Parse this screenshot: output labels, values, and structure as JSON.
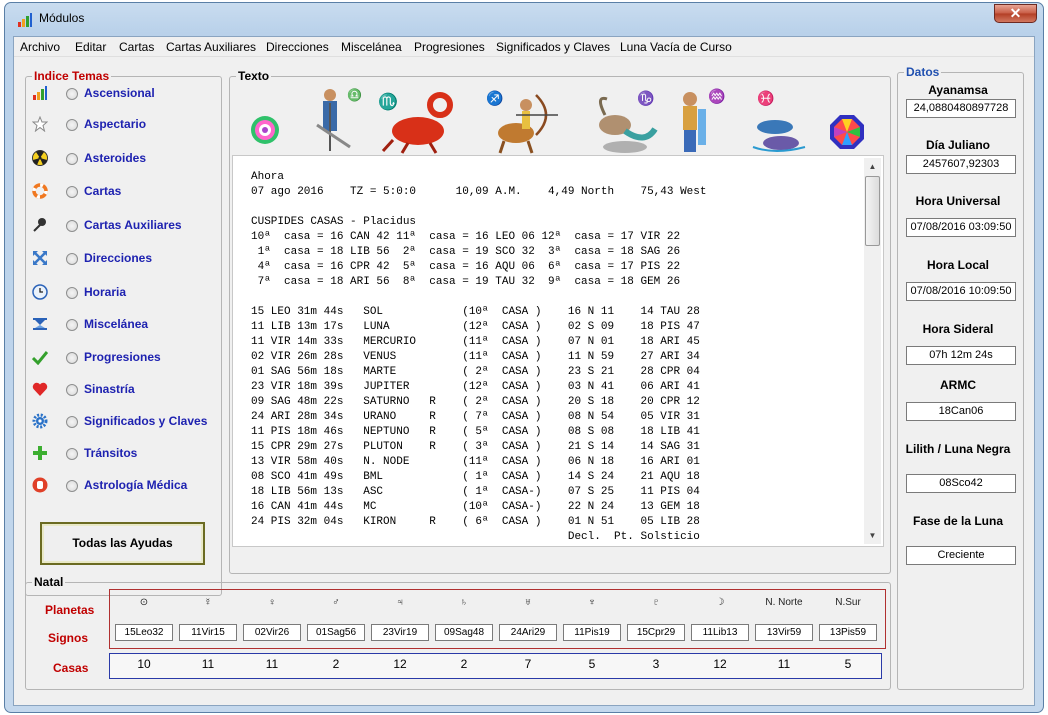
{
  "window": {
    "title": "Módulos",
    "close": "✕"
  },
  "menu": [
    "Archivo",
    "Editar",
    "Cartas",
    "Cartas Auxiliares",
    "Direcciones",
    "Miscelánea",
    "Progresiones",
    "Significados y Claves",
    "Luna Vacía de Curso"
  ],
  "indice": {
    "title": "Indice Temas",
    "items": [
      {
        "label": "Ascensional",
        "icon": "bar-chart-icon"
      },
      {
        "label": "Aspectario",
        "icon": "star-icon"
      },
      {
        "label": "Asteroides",
        "icon": "radiation-icon"
      },
      {
        "label": "Cartas",
        "icon": "lifebuoy-icon"
      },
      {
        "label": "Cartas Auxiliares",
        "icon": "pushpin-icon"
      },
      {
        "label": "Direcciones",
        "icon": "arrows-icon"
      },
      {
        "label": "Horaria",
        "icon": "clock-icon"
      },
      {
        "label": "Miscelánea",
        "icon": "hourglass-icon"
      },
      {
        "label": "Progresiones",
        "icon": "checkmark-icon"
      },
      {
        "label": "Sinastría",
        "icon": "heart-icon"
      },
      {
        "label": "Significados y Claves",
        "icon": "gear-icon"
      },
      {
        "label": "Tránsitos",
        "icon": "plus-icon"
      },
      {
        "label": "Astrología Médica",
        "icon": "hand-icon"
      }
    ],
    "button": "Todas las Ayudas"
  },
  "texto": {
    "title": "Texto",
    "content": "Ahora\n07 ago 2016    TZ = 5:0:0      10,09 A.M.    4,49 North    75,43 West\n\nCUSPIDES CASAS - Placidus\n10ª  casa = 16 CAN 42 11ª  casa = 16 LEO 06 12ª  casa = 17 VIR 22\n 1ª  casa = 18 LIB 56  2ª  casa = 19 SCO 32  3ª  casa = 18 SAG 26\n 4ª  casa = 16 CPR 42  5ª  casa = 16 AQU 06  6ª  casa = 17 PIS 22\n 7ª  casa = 18 ARI 56  8ª  casa = 19 TAU 32  9ª  casa = 18 GEM 26\n\n15 LEO 31m 44s   SOL            (10ª  CASA )    16 N 11    14 TAU 28\n11 LIB 13m 17s   LUNA           (12ª  CASA )    02 S 09    18 PIS 47\n11 VIR 14m 33s   MERCURIO       (11ª  CASA )    07 N 01    18 ARI 45\n02 VIR 26m 28s   VENUS          (11ª  CASA )    11 N 59    27 ARI 34\n01 SAG 56m 18s   MARTE          ( 2ª  CASA )    23 S 21    28 CPR 04\n23 VIR 18m 39s   JUPITER        (12ª  CASA )    03 N 41    06 ARI 41\n09 SAG 48m 22s   SATURNO   R    ( 2ª  CASA )    20 S 18    20 CPR 12\n24 ARI 28m 34s   URANO     R    ( 7ª  CASA )    08 N 54    05 VIR 31\n11 PIS 18m 46s   NEPTUNO   R    ( 5ª  CASA )    08 S 08    18 LIB 41\n15 CPR 29m 27s   PLUTON    R    ( 3ª  CASA )    21 S 14    14 SAG 31\n13 VIR 58m 40s   N. NODE        (11ª  CASA )    06 N 18    16 ARI 01\n08 SCO 41m 49s   BML            ( 1ª  CASA )    14 S 24    21 AQU 18\n18 LIB 56m 13s   ASC            ( 1ª  CASA-)    07 S 25    11 PIS 04\n16 CAN 41m 44s   MC             (10ª  CASA-)    22 N 24    13 GEM 18\n24 PIS 32m 04s   KIRON     R    ( 6ª  CASA )    01 N 51    05 LIB 28\n                                                Decl.  Pt. Solsticio"
  },
  "datos": {
    "title": "Datos",
    "items": [
      {
        "label": "Ayanamsa",
        "value": "24,0880480897728"
      },
      {
        "label": "Día Juliano",
        "value": "2457607,92303"
      },
      {
        "label": "Hora Universal",
        "value": "07/08/2016 03:09:50"
      },
      {
        "label": "Hora Local",
        "value": "07/08/2016 10:09:50"
      },
      {
        "label": "Hora Sideral",
        "value": "07h 12m 24s"
      },
      {
        "label": "ARMC",
        "value": "18Can06"
      },
      {
        "label": "Lilith / Luna Negra",
        "value": "08Sco42"
      },
      {
        "label": "Fase de la Luna",
        "value": "Creciente"
      }
    ]
  },
  "natal": {
    "title": "Natal",
    "labels": {
      "planetas": "Planetas",
      "signos": "Signos",
      "casas": "Casas"
    },
    "planets": [
      {
        "symbol": "⊙",
        "sign": "15Leo32",
        "house": "10"
      },
      {
        "symbol": "☿",
        "sign": "11Vir15",
        "house": "11"
      },
      {
        "symbol": "♀",
        "sign": "02Vir26",
        "house": "11"
      },
      {
        "symbol": "♂",
        "sign": "01Sag56",
        "house": "2"
      },
      {
        "symbol": "♃",
        "sign": "23Vir19",
        "house": "12"
      },
      {
        "symbol": "♄",
        "sign": "09Sag48",
        "house": "2"
      },
      {
        "symbol": "♅",
        "sign": "24Ari29",
        "house": "7"
      },
      {
        "symbol": "♆",
        "sign": "11Pis19",
        "house": "5"
      },
      {
        "symbol": "♇",
        "sign": "15Cpr29",
        "house": "3"
      },
      {
        "symbol": "☽",
        "sign": "11Lib13",
        "house": "12"
      },
      {
        "symbol": "N. Norte",
        "sign": "13Vir59",
        "house": "11"
      },
      {
        "symbol": "N.Sur",
        "sign": "13Pis59",
        "house": "5"
      }
    ]
  }
}
